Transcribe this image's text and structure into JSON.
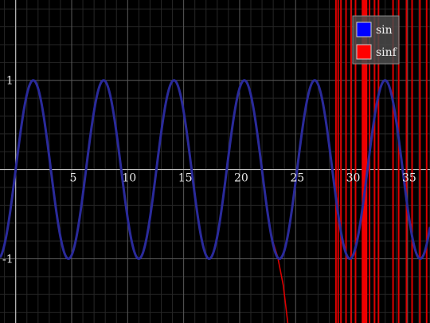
{
  "chart_data": {
    "type": "line",
    "background": "#000000",
    "grid": true,
    "grid_color": "#5a5a5a",
    "axis_color": "#bfbfbf",
    "xlim": [
      -1.4,
      37.0
    ],
    "ylim": [
      -1.72,
      1.9
    ],
    "x_ticks": [
      {
        "value": 5,
        "label": "5"
      },
      {
        "value": 10,
        "label": "10"
      },
      {
        "value": 15,
        "label": "15"
      },
      {
        "value": 20,
        "label": "20"
      },
      {
        "value": 25,
        "label": "25"
      },
      {
        "value": 30,
        "label": "30"
      },
      {
        "value": 35,
        "label": "35"
      }
    ],
    "y_ticks": [
      {
        "value": 1,
        "label": "1"
      },
      {
        "value": -1,
        "label": "-1"
      }
    ],
    "legend": {
      "position": "top-right"
    },
    "series": [
      {
        "name": "sin",
        "color": "#2a2a9a",
        "legend_color": "#0000ff",
        "function": "sin(x)",
        "x_range": [
          -1.4,
          37.0
        ]
      },
      {
        "name": "sinf",
        "color": "#dd0000",
        "legend_color": "#ff0000",
        "function": "sin(x)",
        "x_range": [
          -1.4,
          22.8
        ],
        "divergence": [
          [
            22.8,
            -0.74
          ],
          [
            23.4,
            -0.98
          ],
          [
            23.9,
            -1.3
          ],
          [
            24.3,
            -1.72
          ]
        ],
        "vertical_spikes_x": [
          28.6,
          28.8,
          29.05,
          29.5,
          29.95,
          30.35,
          31.6,
          32.05,
          32.4,
          33.7,
          34.2,
          34.9,
          35.4,
          36.1,
          36.7
        ],
        "vertical_band": [
          30.9,
          31.4
        ]
      }
    ]
  }
}
